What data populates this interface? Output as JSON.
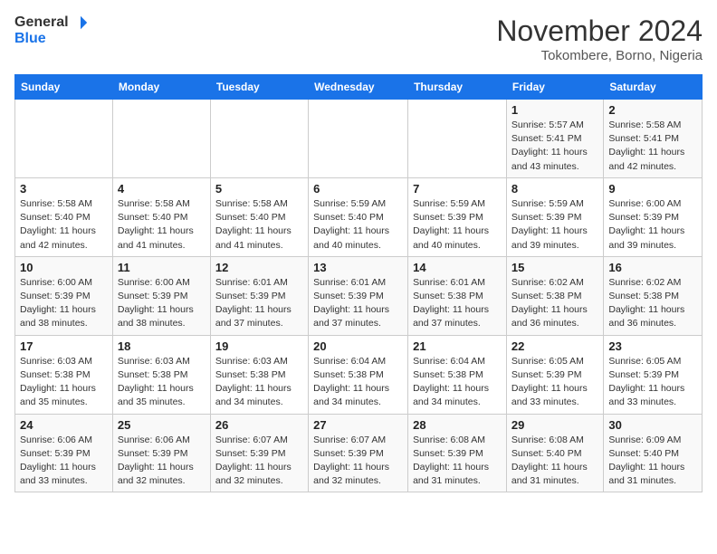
{
  "header": {
    "logo_line1": "General",
    "logo_line2": "Blue",
    "month_title": "November 2024",
    "location": "Tokombere, Borno, Nigeria"
  },
  "calendar": {
    "days_of_week": [
      "Sunday",
      "Monday",
      "Tuesday",
      "Wednesday",
      "Thursday",
      "Friday",
      "Saturday"
    ],
    "weeks": [
      [
        {
          "day": "",
          "info": ""
        },
        {
          "day": "",
          "info": ""
        },
        {
          "day": "",
          "info": ""
        },
        {
          "day": "",
          "info": ""
        },
        {
          "day": "",
          "info": ""
        },
        {
          "day": "1",
          "info": "Sunrise: 5:57 AM\nSunset: 5:41 PM\nDaylight: 11 hours and 43 minutes."
        },
        {
          "day": "2",
          "info": "Sunrise: 5:58 AM\nSunset: 5:41 PM\nDaylight: 11 hours and 42 minutes."
        }
      ],
      [
        {
          "day": "3",
          "info": "Sunrise: 5:58 AM\nSunset: 5:40 PM\nDaylight: 11 hours and 42 minutes."
        },
        {
          "day": "4",
          "info": "Sunrise: 5:58 AM\nSunset: 5:40 PM\nDaylight: 11 hours and 41 minutes."
        },
        {
          "day": "5",
          "info": "Sunrise: 5:58 AM\nSunset: 5:40 PM\nDaylight: 11 hours and 41 minutes."
        },
        {
          "day": "6",
          "info": "Sunrise: 5:59 AM\nSunset: 5:40 PM\nDaylight: 11 hours and 40 minutes."
        },
        {
          "day": "7",
          "info": "Sunrise: 5:59 AM\nSunset: 5:39 PM\nDaylight: 11 hours and 40 minutes."
        },
        {
          "day": "8",
          "info": "Sunrise: 5:59 AM\nSunset: 5:39 PM\nDaylight: 11 hours and 39 minutes."
        },
        {
          "day": "9",
          "info": "Sunrise: 6:00 AM\nSunset: 5:39 PM\nDaylight: 11 hours and 39 minutes."
        }
      ],
      [
        {
          "day": "10",
          "info": "Sunrise: 6:00 AM\nSunset: 5:39 PM\nDaylight: 11 hours and 38 minutes."
        },
        {
          "day": "11",
          "info": "Sunrise: 6:00 AM\nSunset: 5:39 PM\nDaylight: 11 hours and 38 minutes."
        },
        {
          "day": "12",
          "info": "Sunrise: 6:01 AM\nSunset: 5:39 PM\nDaylight: 11 hours and 37 minutes."
        },
        {
          "day": "13",
          "info": "Sunrise: 6:01 AM\nSunset: 5:39 PM\nDaylight: 11 hours and 37 minutes."
        },
        {
          "day": "14",
          "info": "Sunrise: 6:01 AM\nSunset: 5:38 PM\nDaylight: 11 hours and 37 minutes."
        },
        {
          "day": "15",
          "info": "Sunrise: 6:02 AM\nSunset: 5:38 PM\nDaylight: 11 hours and 36 minutes."
        },
        {
          "day": "16",
          "info": "Sunrise: 6:02 AM\nSunset: 5:38 PM\nDaylight: 11 hours and 36 minutes."
        }
      ],
      [
        {
          "day": "17",
          "info": "Sunrise: 6:03 AM\nSunset: 5:38 PM\nDaylight: 11 hours and 35 minutes."
        },
        {
          "day": "18",
          "info": "Sunrise: 6:03 AM\nSunset: 5:38 PM\nDaylight: 11 hours and 35 minutes."
        },
        {
          "day": "19",
          "info": "Sunrise: 6:03 AM\nSunset: 5:38 PM\nDaylight: 11 hours and 34 minutes."
        },
        {
          "day": "20",
          "info": "Sunrise: 6:04 AM\nSunset: 5:38 PM\nDaylight: 11 hours and 34 minutes."
        },
        {
          "day": "21",
          "info": "Sunrise: 6:04 AM\nSunset: 5:38 PM\nDaylight: 11 hours and 34 minutes."
        },
        {
          "day": "22",
          "info": "Sunrise: 6:05 AM\nSunset: 5:39 PM\nDaylight: 11 hours and 33 minutes."
        },
        {
          "day": "23",
          "info": "Sunrise: 6:05 AM\nSunset: 5:39 PM\nDaylight: 11 hours and 33 minutes."
        }
      ],
      [
        {
          "day": "24",
          "info": "Sunrise: 6:06 AM\nSunset: 5:39 PM\nDaylight: 11 hours and 33 minutes."
        },
        {
          "day": "25",
          "info": "Sunrise: 6:06 AM\nSunset: 5:39 PM\nDaylight: 11 hours and 32 minutes."
        },
        {
          "day": "26",
          "info": "Sunrise: 6:07 AM\nSunset: 5:39 PM\nDaylight: 11 hours and 32 minutes."
        },
        {
          "day": "27",
          "info": "Sunrise: 6:07 AM\nSunset: 5:39 PM\nDaylight: 11 hours and 32 minutes."
        },
        {
          "day": "28",
          "info": "Sunrise: 6:08 AM\nSunset: 5:39 PM\nDaylight: 11 hours and 31 minutes."
        },
        {
          "day": "29",
          "info": "Sunrise: 6:08 AM\nSunset: 5:40 PM\nDaylight: 11 hours and 31 minutes."
        },
        {
          "day": "30",
          "info": "Sunrise: 6:09 AM\nSunset: 5:40 PM\nDaylight: 11 hours and 31 minutes."
        }
      ]
    ]
  }
}
